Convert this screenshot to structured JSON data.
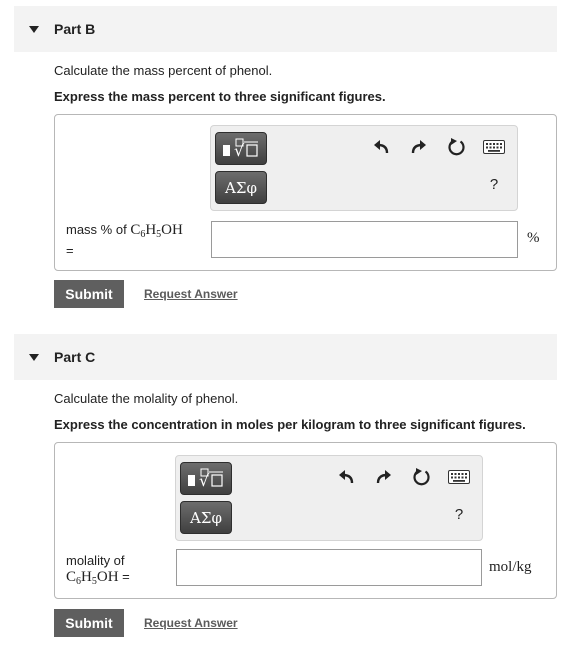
{
  "parts": [
    {
      "title": "Part B",
      "question": "Calculate the mass percent of phenol.",
      "instruction": "Express the mass percent to three significant figures.",
      "greek_button": "ΑΣφ",
      "help": "?",
      "var_prefix": "mass % of",
      "var_formula": [
        "C",
        "6",
        "H",
        "5",
        "OH"
      ],
      "var_suffix": "=",
      "input_value": "",
      "unit": "%",
      "submit": "Submit",
      "request": "Request Answer"
    },
    {
      "title": "Part C",
      "question": "Calculate the molality of phenol.",
      "instruction": "Express the concentration in moles per kilogram to three significant figures.",
      "greek_button": "ΑΣφ",
      "help": "?",
      "var_prefix": "molality of",
      "var_formula": [
        "C",
        "6",
        "H",
        "5",
        "OH"
      ],
      "var_suffix": "=",
      "input_value": "",
      "unit": "mol/kg",
      "submit": "Submit",
      "request": "Request Answer"
    }
  ],
  "icons": [
    "templates-icon",
    "greek-letters-icon",
    "undo-icon",
    "redo-icon",
    "reset-icon",
    "keyboard-icon",
    "help-icon"
  ]
}
